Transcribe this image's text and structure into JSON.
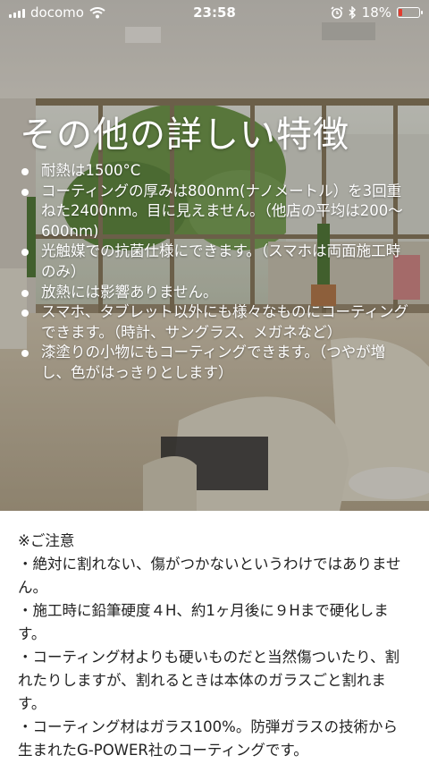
{
  "status_bar": {
    "carrier": "docomo",
    "time": "23:58",
    "battery_percent": "18%",
    "battery_level": 0.18,
    "icons": [
      "signal-icon",
      "wifi-icon",
      "alarm-icon",
      "bluetooth-icon",
      "battery-icon"
    ]
  },
  "hero": {
    "title": "その他の詳しい特徴",
    "features": [
      "耐熱は1500°C",
      "コーティングの厚みは800nm(ナノメートル）を3回重ねた2400nm。目に見えません。（他店の平均は200〜600nm)",
      "光触媒での抗菌仕様にできます。（スマホは両面施工時のみ）",
      "放熱には影響ありません。",
      "スマホ、タブレット以外にも様々なものにコーティングできます。（時計、サングラス、メガネなど）",
      "漆塗りの小物にもコーティングできます。（つやが増し、色がはっきりとします）"
    ]
  },
  "notes": {
    "heading": "※ご注意",
    "items": [
      "・絶対に割れない、傷がつかないというわけではありません。",
      "・施工時に鉛筆硬度４H、約1ヶ月後に９Hまで硬化します。",
      "・コーティング材よりも硬いものだと当然傷ついたり、割れたりしますが、割れるときは本体のガラスごと割れます。",
      "・コーティング材はガラス100%。防弾ガラスの技術から生まれたG-POWER社のコーティングです。"
    ]
  },
  "colors": {
    "battery_low": "#e23b2e",
    "text_dark": "#222222"
  }
}
